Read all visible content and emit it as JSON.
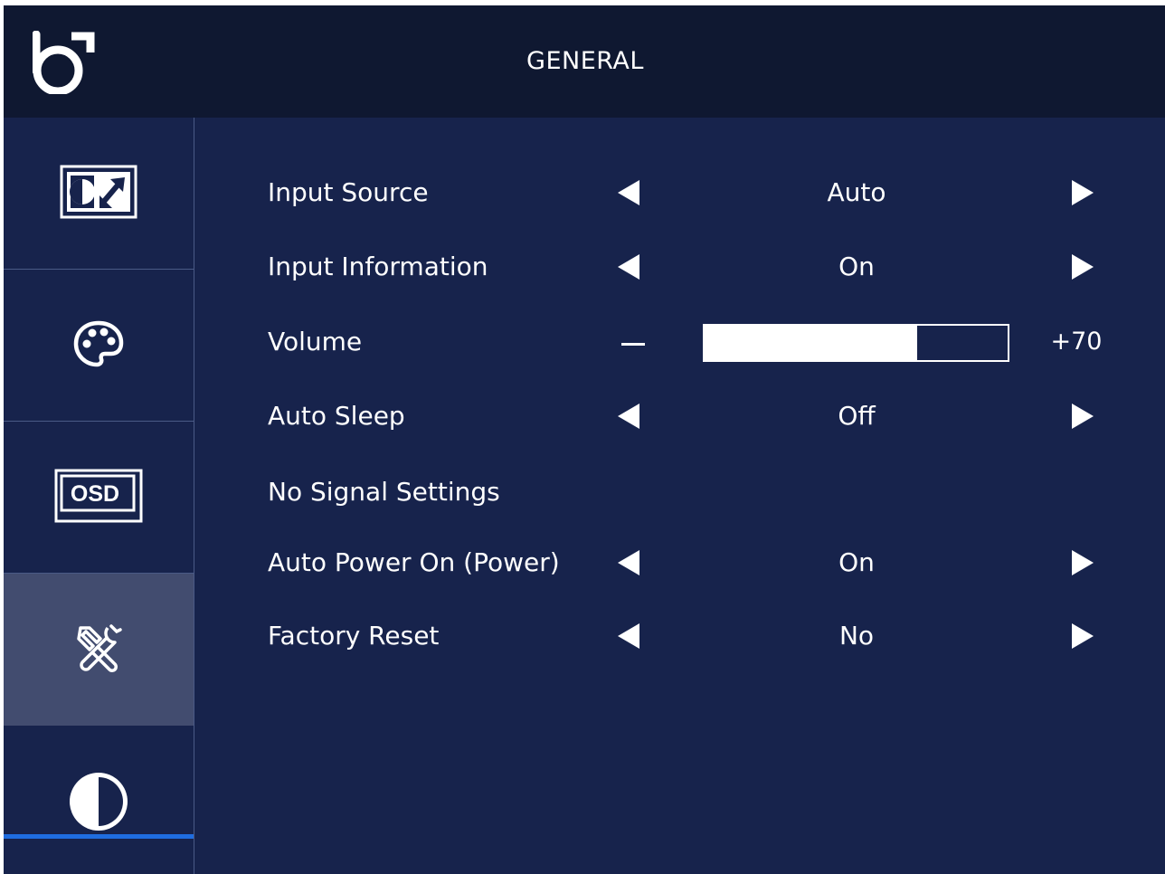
{
  "header": {
    "title": "GENERAL",
    "logo_icon": "brand-logo-icon"
  },
  "sidebar": {
    "items": [
      {
        "icon": "picture-icon",
        "active": false
      },
      {
        "icon": "palette-icon",
        "active": false
      },
      {
        "icon": "osd-icon",
        "label": "OSD",
        "active": false
      },
      {
        "icon": "tools-icon",
        "active": true
      },
      {
        "icon": "contrast-icon",
        "active": false
      }
    ]
  },
  "menu": {
    "rows": [
      {
        "label": "Input Source",
        "value": "Auto"
      },
      {
        "label": "Input Information",
        "value": "On"
      },
      {
        "label": "Volume",
        "value": "+70",
        "level": 0.7
      },
      {
        "label": "Auto Sleep",
        "value": "Off"
      },
      {
        "label": "No Signal Settings"
      },
      {
        "label": "Auto Power On (Power)",
        "value": "On"
      },
      {
        "label": "Factory Reset",
        "value": "No"
      }
    ]
  },
  "colors": {
    "background": "#17234c",
    "header": "#0f1831",
    "sidebar_active": "#424c6f",
    "active_indicator": "#1f6de0",
    "divider": "#4a5a86",
    "text": "#ffffff"
  }
}
